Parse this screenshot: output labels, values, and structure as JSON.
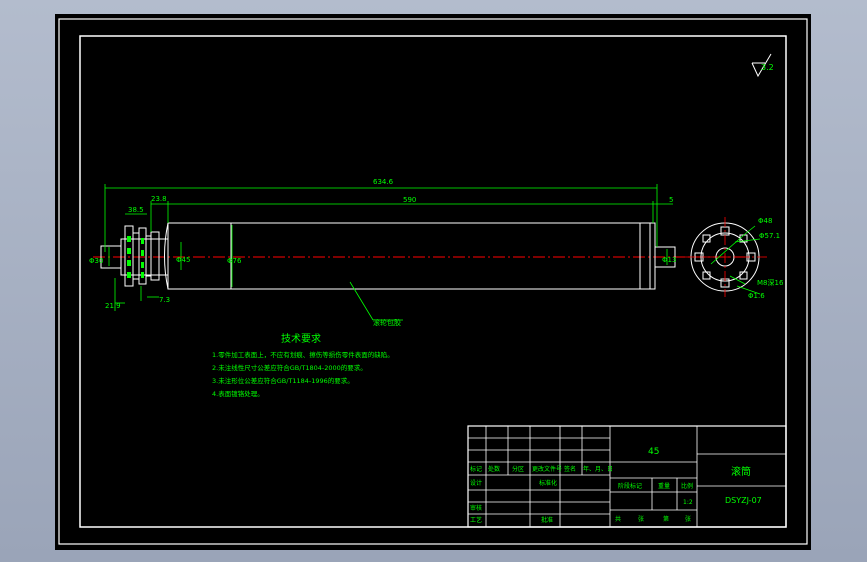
{
  "roughness": "3.2",
  "dimensions": {
    "overall_length": "634.6",
    "body_length": "590",
    "left_offset": "23.8",
    "right_offset": "5",
    "gear_width": "38.5",
    "left_bottom_1": "21.9",
    "left_bottom_2": "7.3",
    "shaft_dia_left": "Φ30",
    "body_dia": "Φ76",
    "bore_dia": "Φ45",
    "shaft_dia_right": "Φ13",
    "end_phi": "Φ48",
    "end_phi_ring": "Φ57.1",
    "end_note": "M8深16",
    "end_phi_small": "Φ1.6"
  },
  "leader_note": "滚轮包胶",
  "tech_title": "技术要求",
  "tech_reqs": [
    "1.零件加工表面上，不应有划痕、擦伤等损伤零件表面的缺陷。",
    "2.未注线性尺寸公差应符合GB/T1804-2000的要求。",
    "3.未注形位公差应符合GB/T1184-1996的要求。",
    "4.表面镀铬处理。"
  ],
  "title_block": {
    "material": "45",
    "part_name": "滚筒",
    "drawing_no": "DSYZJ-07",
    "scale": "1:2",
    "row_headers": [
      "标记",
      "处数",
      "分区",
      "更改文件号",
      "签名",
      "年、月、日"
    ],
    "design": "设计",
    "standardize": "标准化",
    "review": "审核",
    "process": "工艺",
    "approve": "批准",
    "stage_mark": "阶段标记",
    "weight": "重量",
    "scale_label": "比例",
    "sheets": [
      "共",
      "张",
      "第",
      "张"
    ]
  }
}
